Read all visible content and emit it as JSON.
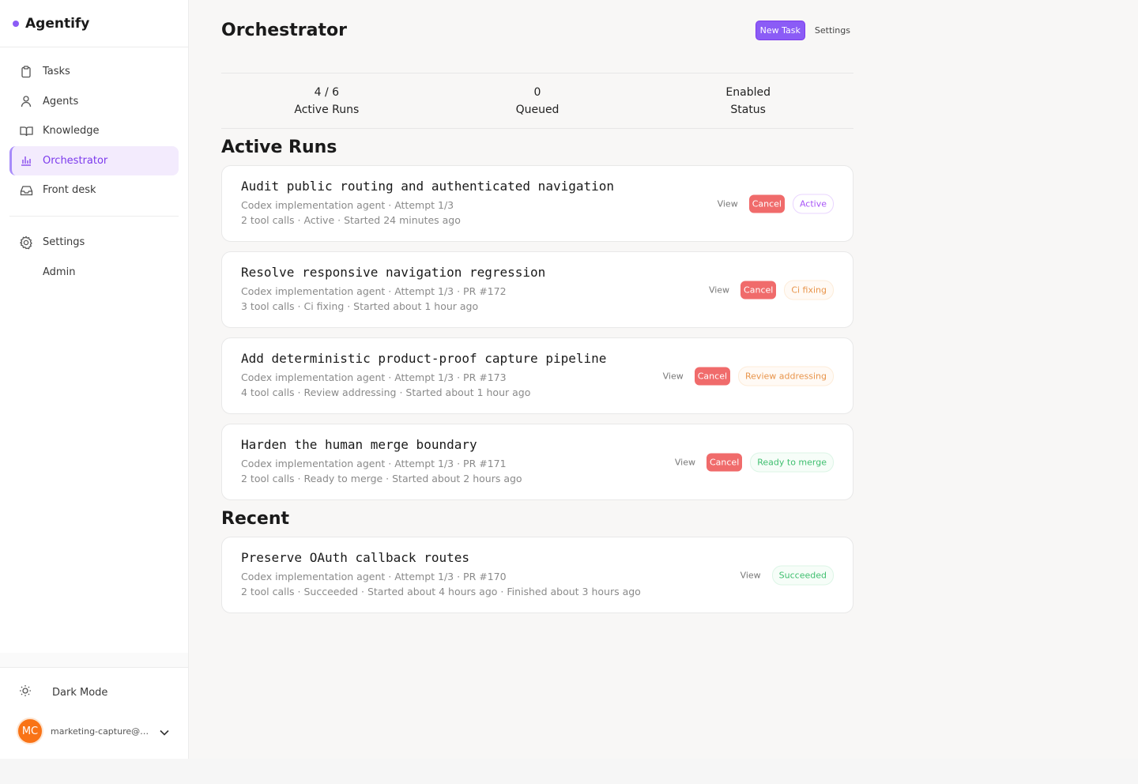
{
  "app": {
    "name": "Agentify",
    "accent": "#8b5cf6"
  },
  "sidebar": {
    "items": [
      {
        "label": "Tasks",
        "icon": "clipboard-icon"
      },
      {
        "label": "Agents",
        "icon": "user-icon"
      },
      {
        "label": "Knowledge",
        "icon": "book-icon"
      },
      {
        "label": "Orchestrator",
        "icon": "bar-chart-icon",
        "active": true
      },
      {
        "label": "Front desk",
        "icon": "inbox-icon"
      }
    ],
    "settings": {
      "label": "Settings",
      "icon": "gear-icon"
    },
    "admin": {
      "label": "Admin"
    },
    "dark_mode": {
      "label": "Dark Mode",
      "icon": "sun-icon"
    },
    "user": {
      "initials": "MC",
      "email": "marketing-capture@ag…",
      "avatar_color": "#f97316"
    }
  },
  "header": {
    "title": "Orchestrator",
    "new_task_label": "New Task",
    "settings_label": "Settings"
  },
  "stats": [
    {
      "value": "4 / 6",
      "label": "Active Runs"
    },
    {
      "value": "0",
      "label": "Queued"
    },
    {
      "value": "Enabled",
      "label": "Status"
    }
  ],
  "active_runs": {
    "title": "Active Runs",
    "items": [
      {
        "title": "Audit public routing and authenticated navigation",
        "meta1": "Codex implementation agent · Attempt 1/3",
        "meta2": "2 tool calls · Active · Started 24 minutes ago",
        "view": "View",
        "cancel": "Cancel",
        "status": "Active"
      },
      {
        "title": "Resolve responsive navigation regression",
        "meta1": "Codex implementation agent · Attempt 1/3 ·  PR #172",
        "meta2": "3 tool calls · Ci fixing · Started about 1 hour ago",
        "view": "View",
        "cancel": "Cancel",
        "status": "Ci fixing"
      },
      {
        "title": "Add deterministic product-proof capture pipeline",
        "meta1": "Codex implementation agent · Attempt 1/3 ·  PR #173",
        "meta2": "4 tool calls · Review addressing · Started about 1 hour ago",
        "view": "View",
        "cancel": "Cancel",
        "status": "Review addressing"
      },
      {
        "title": "Harden the human merge boundary",
        "meta1": "Codex implementation agent · Attempt 1/3 ·  PR #171",
        "meta2": "2 tool calls · Ready to merge · Started about 2 hours ago",
        "view": "View",
        "cancel": "Cancel",
        "status": "Ready to merge"
      }
    ]
  },
  "recent": {
    "title": "Recent",
    "items": [
      {
        "title": "Preserve OAuth callback routes",
        "meta1": "Codex implementation agent · Attempt 1/3 ·  PR #170",
        "meta2": "2 tool calls · Succeeded · Started about 4 hours ago · Finished about 3 hours ago",
        "view": "View",
        "status": "Succeeded"
      }
    ]
  }
}
